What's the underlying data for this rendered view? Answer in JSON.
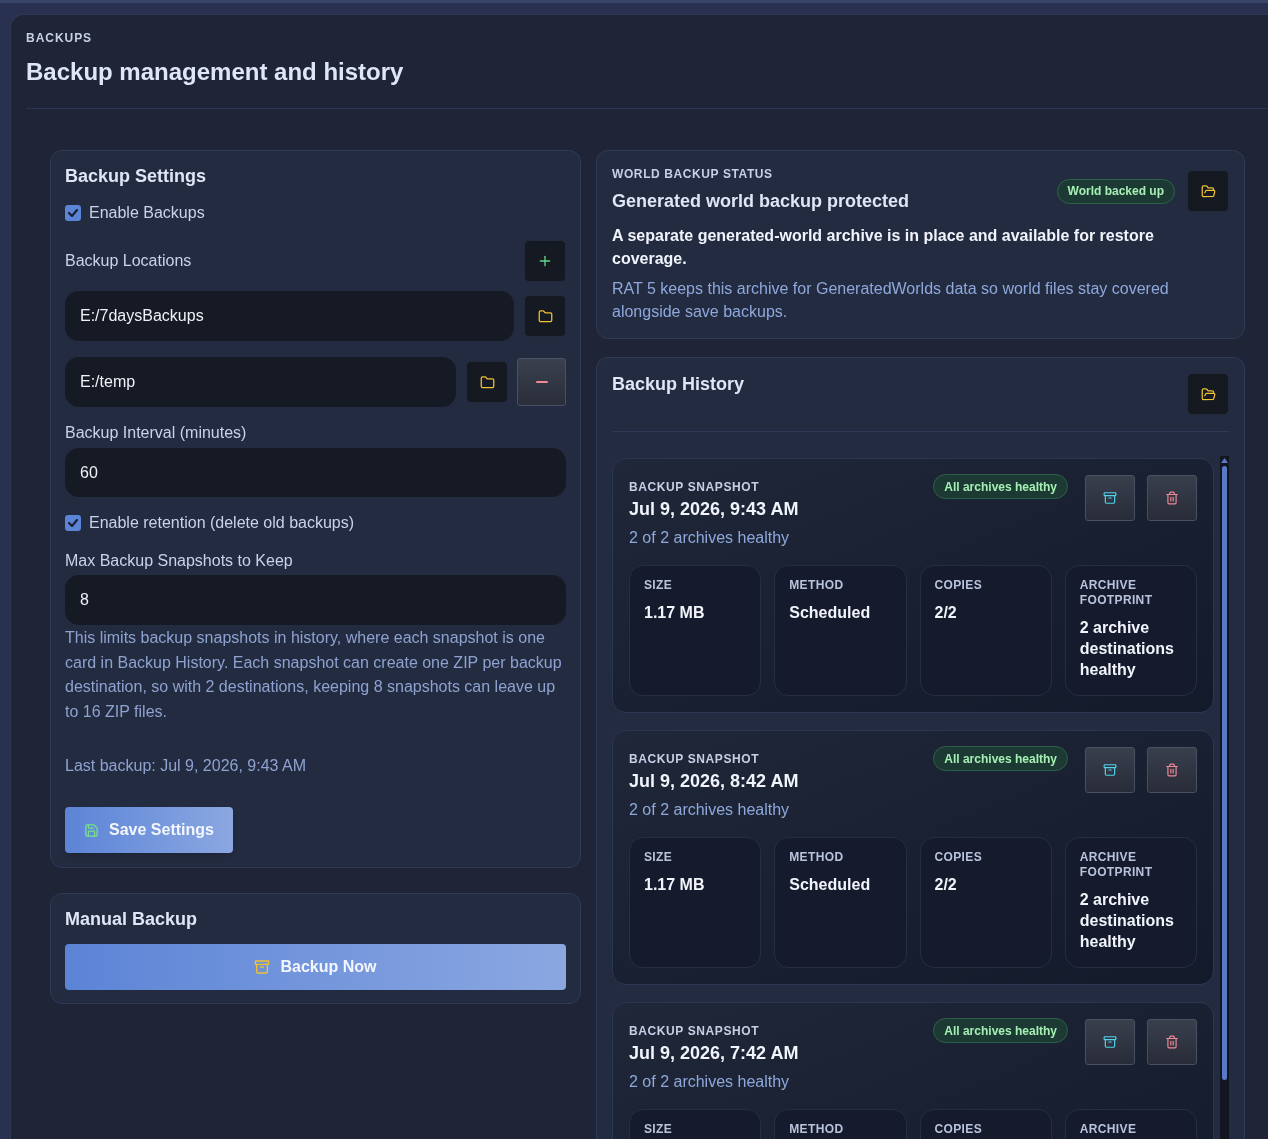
{
  "header": {
    "eyebrow": "BACKUPS",
    "title": "Backup management and history"
  },
  "settings": {
    "title": "Backup Settings",
    "enable_backups": {
      "label": "Enable Backups",
      "checked": true
    },
    "locations": {
      "label": "Backup Locations",
      "items": [
        {
          "path": "E:/7daysBackups",
          "removable": false
        },
        {
          "path": "E:/temp",
          "removable": true
        }
      ]
    },
    "interval": {
      "label": "Backup Interval (minutes)",
      "value": "60"
    },
    "retention": {
      "label": "Enable retention (delete old backups)",
      "checked": true
    },
    "max_snapshots": {
      "label": "Max Backup Snapshots to Keep",
      "value": "8"
    },
    "help_text": "This limits backup snapshots in history, where each snapshot is one card in Backup History. Each snapshot can create one ZIP per backup destination, so with 2 destinations, keeping 8 snapshots can leave up to 16 ZIP files.",
    "last_backup": "Last backup: Jul 9, 2026, 9:43 AM",
    "save_button": "Save Settings"
  },
  "manual_backup": {
    "title": "Manual Backup",
    "button": "Backup Now"
  },
  "world_status": {
    "eyebrow": "WORLD BACKUP STATUS",
    "title": "Generated world backup protected",
    "badge": "World backed up",
    "summary": "A separate generated-world archive is in place and available for restore coverage.",
    "detail": "RAT 5 keeps this archive for GeneratedWorlds data so world files stay covered alongside save backups."
  },
  "history": {
    "title": "Backup History",
    "snapshots": [
      {
        "eyebrow": "BACKUP SNAPSHOT",
        "date": "Jul 9, 2026, 9:43 AM",
        "health": "2 of 2 archives healthy",
        "badge": "All archives healthy",
        "stats": [
          {
            "label": "SIZE",
            "value": "1.17 MB"
          },
          {
            "label": "METHOD",
            "value": "Scheduled"
          },
          {
            "label": "COPIES",
            "value": "2/2"
          },
          {
            "label": "ARCHIVE FOOTPRINT",
            "value": "2 archive destinations healthy"
          }
        ]
      },
      {
        "eyebrow": "BACKUP SNAPSHOT",
        "date": "Jul 9, 2026, 8:42 AM",
        "health": "2 of 2 archives healthy",
        "badge": "All archives healthy",
        "stats": [
          {
            "label": "SIZE",
            "value": "1.17 MB"
          },
          {
            "label": "METHOD",
            "value": "Scheduled"
          },
          {
            "label": "COPIES",
            "value": "2/2"
          },
          {
            "label": "ARCHIVE FOOTPRINT",
            "value": "2 archive destinations healthy"
          }
        ]
      },
      {
        "eyebrow": "BACKUP SNAPSHOT",
        "date": "Jul 9, 2026, 7:42 AM",
        "health": "2 of 2 archives healthy",
        "badge": "All archives healthy",
        "stats": [
          {
            "label": "SIZE"
          },
          {
            "label": "METHOD"
          },
          {
            "label": "COPIES"
          },
          {
            "label": "ARCHIVE"
          }
        ]
      }
    ]
  }
}
